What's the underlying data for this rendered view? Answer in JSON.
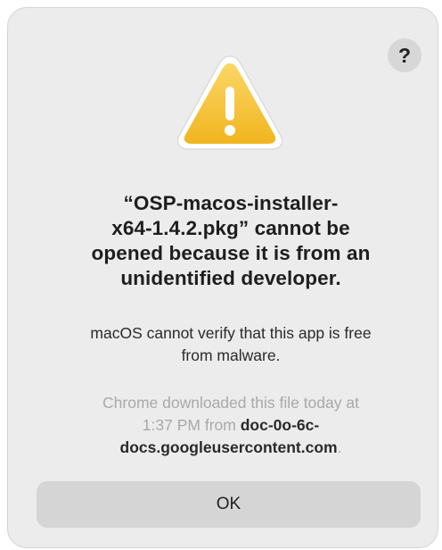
{
  "dialog": {
    "help_label": "?",
    "icon": "warning-triangle-icon",
    "title": "“OSP-macos-installer-x64-1.4.2.pkg” cannot be opened because it is from an unidentified developer.",
    "title_lines": [
      "“OSP-macos-installer-",
      "x64-1.4.2.pkg” cannot be",
      "opened because it is from an",
      "unidentified developer."
    ],
    "message_lines": [
      "macOS cannot verify that this app is free",
      "from malware."
    ],
    "source": {
      "line1": "Chrome downloaded this file today at",
      "line2_prefix": "1:37 PM from ",
      "domain_part1": "doc-0o-6c-",
      "domain_part2": "docs.googleusercontent.com",
      "line3_suffix": "."
    },
    "ok_label": "OK"
  },
  "colors": {
    "warning_fill": "#f6c443",
    "warning_border": "#ffffff",
    "dialog_bg": "#ececec",
    "button_bg": "#d5d5d5"
  }
}
